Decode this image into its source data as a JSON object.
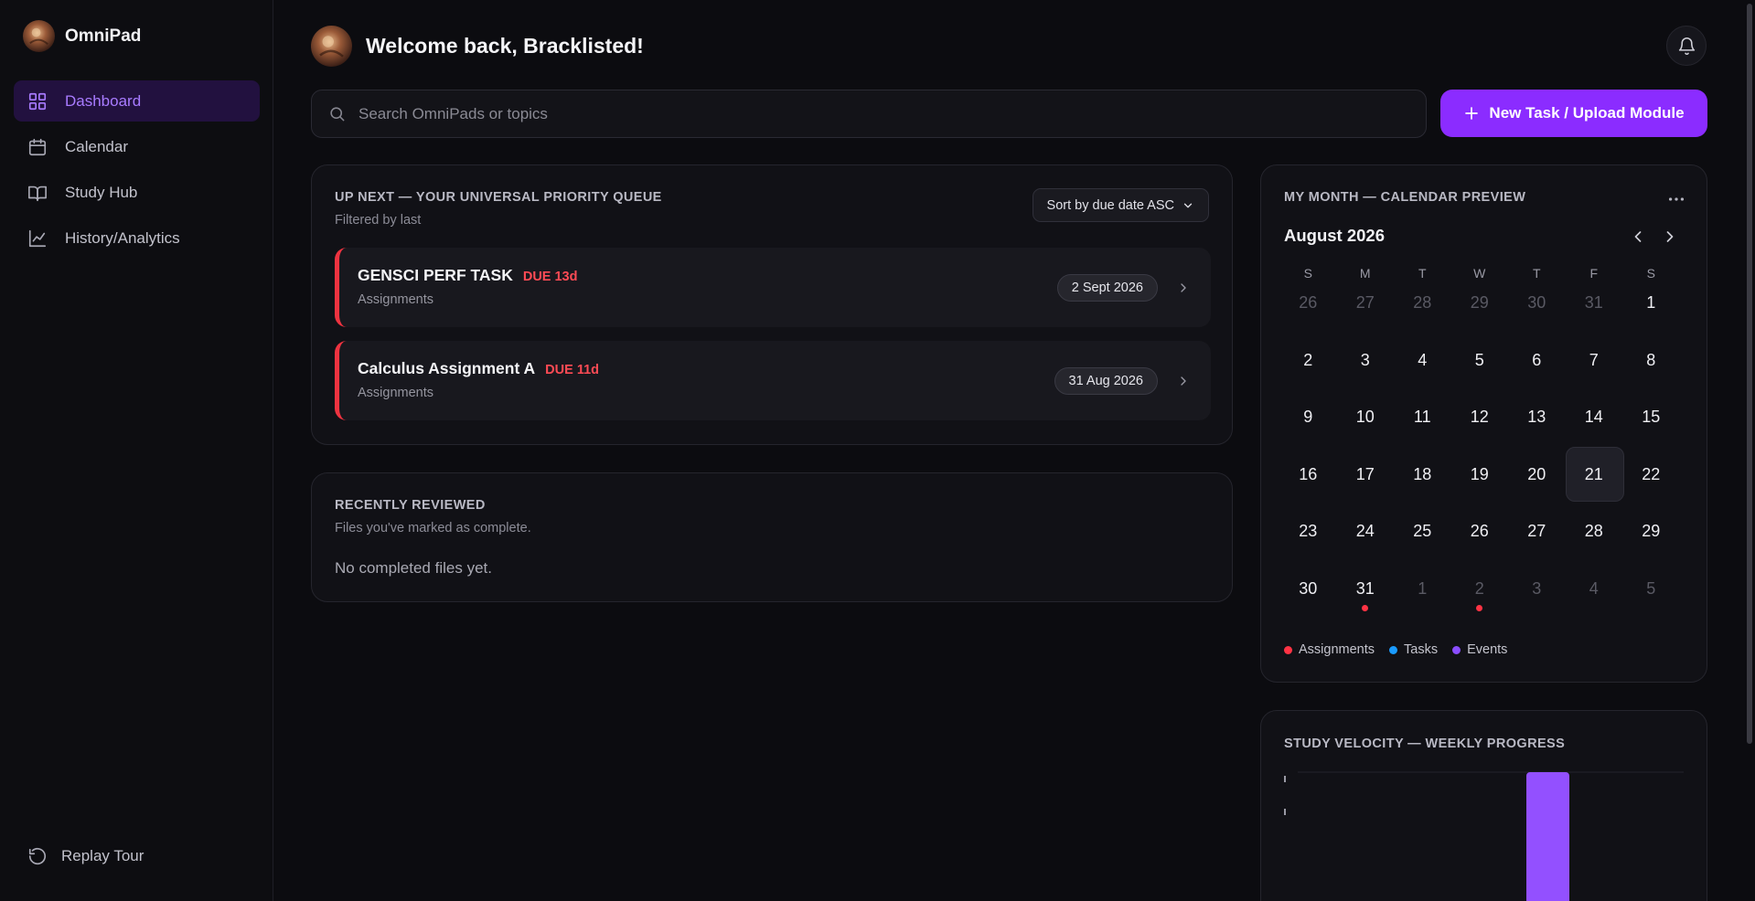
{
  "app": {
    "name": "OmniPad"
  },
  "sidebar": {
    "items": [
      {
        "label": "Dashboard",
        "icon": "dashboard-grid-icon",
        "active": true
      },
      {
        "label": "Calendar",
        "icon": "calendar-icon",
        "active": false
      },
      {
        "label": "Study Hub",
        "icon": "book-icon",
        "active": false
      },
      {
        "label": "History/Analytics",
        "icon": "line-chart-icon",
        "active": false
      }
    ],
    "replay_label": "Replay Tour"
  },
  "header": {
    "welcome": "Welcome back, Bracklisted!"
  },
  "search": {
    "placeholder": "Search OmniPads or topics",
    "value": ""
  },
  "new_task_label": "New Task / Upload Module",
  "queue": {
    "title": "UP NEXT — YOUR UNIVERSAL PRIORITY QUEUE",
    "subtitle": "Filtered by last",
    "sort_label": "Sort by due date ASC",
    "tasks": [
      {
        "title": "GENSCI PERF TASK",
        "due": "DUE 13d",
        "category": "Assignments",
        "date": "2 Sept 2026"
      },
      {
        "title": "Calculus Assignment A",
        "due": "DUE 11d",
        "category": "Assignments",
        "date": "31 Aug 2026"
      }
    ]
  },
  "recent": {
    "title": "RECENTLY REVIEWED",
    "subtitle": "Files you've marked as complete.",
    "empty": "No completed files yet."
  },
  "calendar": {
    "title": "MY MONTH — CALENDAR PREVIEW",
    "month": "August 2026",
    "weekdays": [
      "S",
      "M",
      "T",
      "W",
      "T",
      "F",
      "S"
    ],
    "days": [
      {
        "d": "26",
        "muted": true
      },
      {
        "d": "27",
        "muted": true
      },
      {
        "d": "28",
        "muted": true
      },
      {
        "d": "29",
        "muted": true
      },
      {
        "d": "30",
        "muted": true
      },
      {
        "d": "31",
        "muted": true
      },
      {
        "d": "1"
      },
      {
        "d": "2"
      },
      {
        "d": "3"
      },
      {
        "d": "4"
      },
      {
        "d": "5"
      },
      {
        "d": "6"
      },
      {
        "d": "7"
      },
      {
        "d": "8"
      },
      {
        "d": "9"
      },
      {
        "d": "10"
      },
      {
        "d": "11"
      },
      {
        "d": "12"
      },
      {
        "d": "13"
      },
      {
        "d": "14"
      },
      {
        "d": "15"
      },
      {
        "d": "16"
      },
      {
        "d": "17"
      },
      {
        "d": "18"
      },
      {
        "d": "19"
      },
      {
        "d": "20"
      },
      {
        "d": "21",
        "today": true
      },
      {
        "d": "22"
      },
      {
        "d": "23"
      },
      {
        "d": "24"
      },
      {
        "d": "25"
      },
      {
        "d": "26"
      },
      {
        "d": "27"
      },
      {
        "d": "28"
      },
      {
        "d": "29"
      },
      {
        "d": "30"
      },
      {
        "d": "31",
        "dot": true
      },
      {
        "d": "1",
        "muted": true
      },
      {
        "d": "2",
        "muted": true,
        "dot": true
      },
      {
        "d": "3",
        "muted": true
      },
      {
        "d": "4",
        "muted": true
      },
      {
        "d": "5",
        "muted": true
      }
    ],
    "legend": [
      {
        "label": "Assignments",
        "color": "#ff3344"
      },
      {
        "label": "Tasks",
        "color": "#1a9bff"
      },
      {
        "label": "Events",
        "color": "#8a4dff"
      }
    ]
  },
  "velocity": {
    "title": "STUDY VELOCITY — WEEKLY PROGRESS",
    "bar_color": "#9350ff"
  },
  "colors": {
    "accent": "#8b2cff",
    "danger": "#ff4b55"
  }
}
